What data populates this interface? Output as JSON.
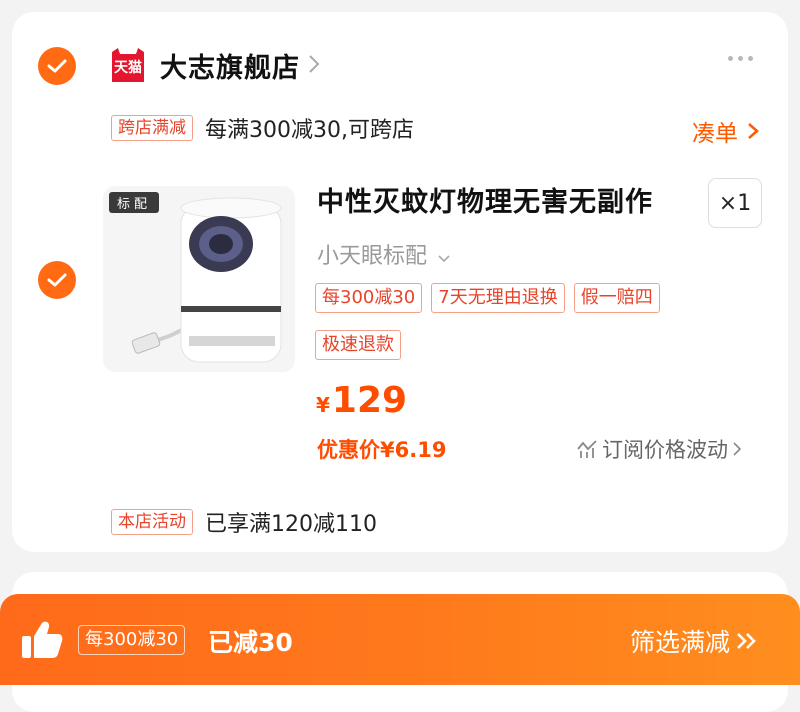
{
  "shop": {
    "logo_text": "天猫",
    "name": "大志旗舰店"
  },
  "promo": {
    "tag": "跨店满减",
    "text": "每满300减30,可跨店",
    "coudan": "凑单"
  },
  "item": {
    "image_badge": "标配",
    "title": "中性灭蚊灯物理无害无副作",
    "quantity": "×1",
    "sku": "小天眼标配",
    "tags_row1": [
      "每300减30",
      "7天无理由退换",
      "假一赔四"
    ],
    "tag_row2": "极速退款",
    "currency": "¥",
    "price": "129",
    "discount_price": "优惠价¥6.19",
    "subscribe": "订阅价格波动"
  },
  "shop_activity": {
    "tag": "本店活动",
    "text": "已享满120减110"
  },
  "bottom_bar": {
    "tag": "每300减30",
    "reduced": "已减30",
    "filter": "筛选满减"
  },
  "colors": {
    "accent": "#ff6a13",
    "price": "#ff4d00",
    "tag_red": "#e8442c",
    "tmall_red": "#e3162f"
  }
}
